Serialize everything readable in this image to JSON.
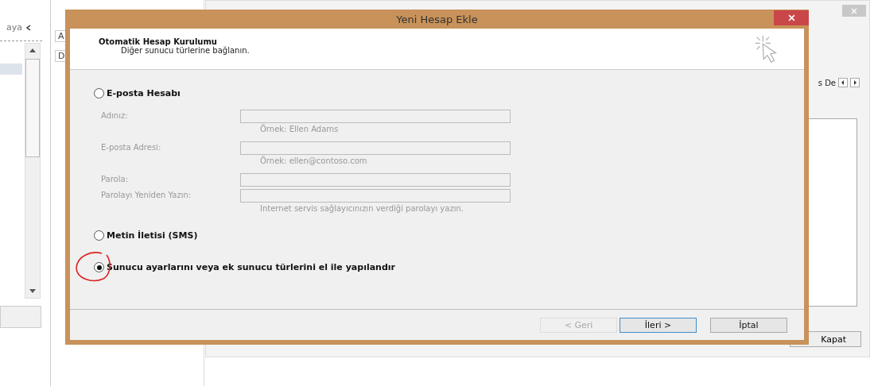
{
  "background_window": {
    "left_pane": {
      "label": "aya",
      "column_letters": [
        "A",
        "D"
      ]
    },
    "right_pane": {
      "label": "s De",
      "close_button": "Kapat"
    }
  },
  "dialog": {
    "title": "Yeni Hesap Ekle",
    "header": {
      "title": "Otomatik Hesap Kurulumu",
      "subtitle": "Diğer sunucu türlerine bağlanın."
    },
    "options": [
      {
        "label": "E-posta Hesabı",
        "selected": false
      },
      {
        "label": "Metin İletisi (SMS)",
        "selected": false
      },
      {
        "label": "Sunucu ayarlarını veya ek sunucu türlerini el ile yapılandır",
        "selected": true,
        "annotated": true
      }
    ],
    "fields_disabled": true,
    "fields": [
      {
        "label": "Adınız:",
        "hint": "Örnek: Ellen Adams"
      },
      {
        "label": "E-posta Adresi:",
        "hint": "Örnek: ellen@contoso.com"
      },
      {
        "label": "Parola:"
      },
      {
        "label": "Parolayı Yeniden Yazın:",
        "hint": "Internet servis sağlayıcınızın verdiği parolayı yazın."
      }
    ],
    "buttons": [
      {
        "label": "< Geri",
        "disabled": true,
        "default": false
      },
      {
        "label": "İleri >",
        "disabled": false,
        "default": true
      },
      {
        "label": "İptal",
        "disabled": false,
        "default": false
      }
    ]
  }
}
